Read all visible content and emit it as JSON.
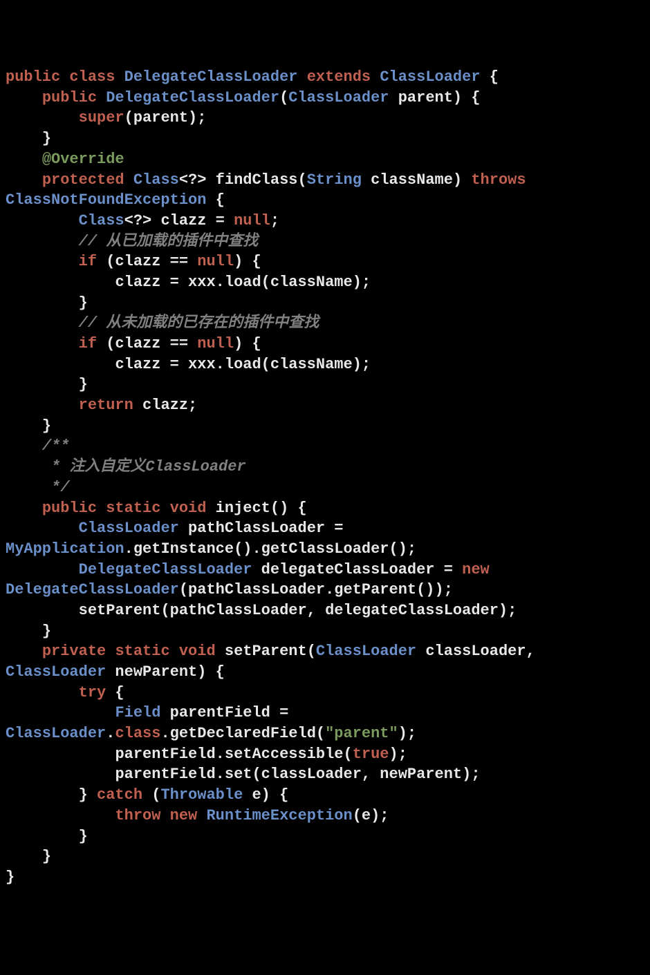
{
  "code": {
    "tokens": [
      {
        "cls": "kw",
        "t": "public"
      },
      {
        "cls": "punc",
        "t": " "
      },
      {
        "cls": "kw",
        "t": "class"
      },
      {
        "cls": "punc",
        "t": " "
      },
      {
        "cls": "type",
        "t": "DelegateClassLoader"
      },
      {
        "cls": "punc",
        "t": " "
      },
      {
        "cls": "kw",
        "t": "extends"
      },
      {
        "cls": "punc",
        "t": " "
      },
      {
        "cls": "type",
        "t": "ClassLoader"
      },
      {
        "cls": "punc",
        "t": " {\n"
      },
      {
        "cls": "punc",
        "t": "    "
      },
      {
        "cls": "kw",
        "t": "public"
      },
      {
        "cls": "punc",
        "t": " "
      },
      {
        "cls": "type",
        "t": "DelegateClassLoader"
      },
      {
        "cls": "punc",
        "t": "("
      },
      {
        "cls": "type",
        "t": "ClassLoader"
      },
      {
        "cls": "punc",
        "t": " parent) {\n"
      },
      {
        "cls": "punc",
        "t": "        "
      },
      {
        "cls": "kw",
        "t": "super"
      },
      {
        "cls": "punc",
        "t": "(parent);\n"
      },
      {
        "cls": "punc",
        "t": "    }\n"
      },
      {
        "cls": "punc",
        "t": "    "
      },
      {
        "cls": "ann",
        "t": "@Override"
      },
      {
        "cls": "punc",
        "t": "\n"
      },
      {
        "cls": "punc",
        "t": "    "
      },
      {
        "cls": "kw",
        "t": "protected"
      },
      {
        "cls": "punc",
        "t": " "
      },
      {
        "cls": "type",
        "t": "Class"
      },
      {
        "cls": "punc",
        "t": "<?> "
      },
      {
        "cls": "method",
        "t": "findClass"
      },
      {
        "cls": "punc",
        "t": "("
      },
      {
        "cls": "type",
        "t": "String"
      },
      {
        "cls": "punc",
        "t": " className) "
      },
      {
        "cls": "kw",
        "t": "throws"
      },
      {
        "cls": "punc",
        "t": " "
      },
      {
        "cls": "type",
        "t": "ClassNotFoundException"
      },
      {
        "cls": "punc",
        "t": " {\n"
      },
      {
        "cls": "punc",
        "t": "        "
      },
      {
        "cls": "type",
        "t": "Class"
      },
      {
        "cls": "punc",
        "t": "<?> clazz = "
      },
      {
        "cls": "null",
        "t": "null"
      },
      {
        "cls": "punc",
        "t": ";\n"
      },
      {
        "cls": "punc",
        "t": "        "
      },
      {
        "cls": "comment",
        "t": "// 从已加载的插件中查找"
      },
      {
        "cls": "punc",
        "t": "\n"
      },
      {
        "cls": "punc",
        "t": "        "
      },
      {
        "cls": "kw",
        "t": "if"
      },
      {
        "cls": "punc",
        "t": " (clazz == "
      },
      {
        "cls": "null",
        "t": "null"
      },
      {
        "cls": "punc",
        "t": ") {\n"
      },
      {
        "cls": "punc",
        "t": "            clazz = xxx.load(className);\n"
      },
      {
        "cls": "punc",
        "t": "        }\n"
      },
      {
        "cls": "punc",
        "t": "        "
      },
      {
        "cls": "comment",
        "t": "// 从未加载的已存在的插件中查找"
      },
      {
        "cls": "punc",
        "t": "\n"
      },
      {
        "cls": "punc",
        "t": "        "
      },
      {
        "cls": "kw",
        "t": "if"
      },
      {
        "cls": "punc",
        "t": " (clazz == "
      },
      {
        "cls": "null",
        "t": "null"
      },
      {
        "cls": "punc",
        "t": ") {\n"
      },
      {
        "cls": "punc",
        "t": "            clazz = xxx.load(className);\n"
      },
      {
        "cls": "punc",
        "t": "        }\n"
      },
      {
        "cls": "punc",
        "t": "        "
      },
      {
        "cls": "kw",
        "t": "return"
      },
      {
        "cls": "punc",
        "t": " clazz;\n"
      },
      {
        "cls": "punc",
        "t": "    }\n"
      },
      {
        "cls": "punc",
        "t": "    "
      },
      {
        "cls": "comment",
        "t": "/**"
      },
      {
        "cls": "punc",
        "t": "\n"
      },
      {
        "cls": "punc",
        "t": "     "
      },
      {
        "cls": "comment",
        "t": "* 注入自定义ClassLoader"
      },
      {
        "cls": "punc",
        "t": "\n"
      },
      {
        "cls": "punc",
        "t": "     "
      },
      {
        "cls": "comment",
        "t": "*/"
      },
      {
        "cls": "punc",
        "t": "\n"
      },
      {
        "cls": "punc",
        "t": "    "
      },
      {
        "cls": "kw",
        "t": "public"
      },
      {
        "cls": "punc",
        "t": " "
      },
      {
        "cls": "kw",
        "t": "static"
      },
      {
        "cls": "punc",
        "t": " "
      },
      {
        "cls": "kw",
        "t": "void"
      },
      {
        "cls": "punc",
        "t": " "
      },
      {
        "cls": "method",
        "t": "inject"
      },
      {
        "cls": "punc",
        "t": "() {\n"
      },
      {
        "cls": "punc",
        "t": "        "
      },
      {
        "cls": "type",
        "t": "ClassLoader"
      },
      {
        "cls": "punc",
        "t": " pathClassLoader = "
      },
      {
        "cls": "type",
        "t": "MyApplication"
      },
      {
        "cls": "punc",
        "t": ".getInstance().getClassLoader();\n"
      },
      {
        "cls": "punc",
        "t": "        "
      },
      {
        "cls": "type",
        "t": "DelegateClassLoader"
      },
      {
        "cls": "punc",
        "t": " delegateClassLoader = "
      },
      {
        "cls": "kw",
        "t": "new"
      },
      {
        "cls": "punc",
        "t": " "
      },
      {
        "cls": "type",
        "t": "DelegateClassLoader"
      },
      {
        "cls": "punc",
        "t": "(pathClassLoader.getParent());\n"
      },
      {
        "cls": "punc",
        "t": "        setParent(pathClassLoader, delegateClassLoader);\n"
      },
      {
        "cls": "punc",
        "t": "    }\n"
      },
      {
        "cls": "punc",
        "t": "    "
      },
      {
        "cls": "kw",
        "t": "private"
      },
      {
        "cls": "punc",
        "t": " "
      },
      {
        "cls": "kw",
        "t": "static"
      },
      {
        "cls": "punc",
        "t": " "
      },
      {
        "cls": "kw",
        "t": "void"
      },
      {
        "cls": "punc",
        "t": " "
      },
      {
        "cls": "method",
        "t": "setParent"
      },
      {
        "cls": "punc",
        "t": "("
      },
      {
        "cls": "type",
        "t": "ClassLoader"
      },
      {
        "cls": "punc",
        "t": " classLoader, "
      },
      {
        "cls": "type",
        "t": "ClassLoader"
      },
      {
        "cls": "punc",
        "t": " newParent) {\n"
      },
      {
        "cls": "punc",
        "t": "        "
      },
      {
        "cls": "kw",
        "t": "try"
      },
      {
        "cls": "punc",
        "t": " {\n"
      },
      {
        "cls": "punc",
        "t": "            "
      },
      {
        "cls": "type",
        "t": "Field"
      },
      {
        "cls": "punc",
        "t": " parentField = "
      },
      {
        "cls": "type",
        "t": "ClassLoader"
      },
      {
        "cls": "punc",
        "t": "."
      },
      {
        "cls": "kw",
        "t": "class"
      },
      {
        "cls": "punc",
        "t": ".getDeclaredField("
      },
      {
        "cls": "str",
        "t": "\"parent\""
      },
      {
        "cls": "punc",
        "t": ");\n"
      },
      {
        "cls": "punc",
        "t": "            parentField.setAccessible("
      },
      {
        "cls": "bool",
        "t": "true"
      },
      {
        "cls": "punc",
        "t": ");\n"
      },
      {
        "cls": "punc",
        "t": "            parentField.set(classLoader, newParent);\n"
      },
      {
        "cls": "punc",
        "t": "        } "
      },
      {
        "cls": "kw",
        "t": "catch"
      },
      {
        "cls": "punc",
        "t": " ("
      },
      {
        "cls": "type",
        "t": "Throwable"
      },
      {
        "cls": "punc",
        "t": " e) {\n"
      },
      {
        "cls": "punc",
        "t": "            "
      },
      {
        "cls": "kw",
        "t": "throw"
      },
      {
        "cls": "punc",
        "t": " "
      },
      {
        "cls": "kw",
        "t": "new"
      },
      {
        "cls": "punc",
        "t": " "
      },
      {
        "cls": "type",
        "t": "RuntimeException"
      },
      {
        "cls": "punc",
        "t": "(e);\n"
      },
      {
        "cls": "punc",
        "t": "        }\n"
      },
      {
        "cls": "punc",
        "t": "    }\n"
      },
      {
        "cls": "punc",
        "t": "}\n"
      }
    ]
  }
}
